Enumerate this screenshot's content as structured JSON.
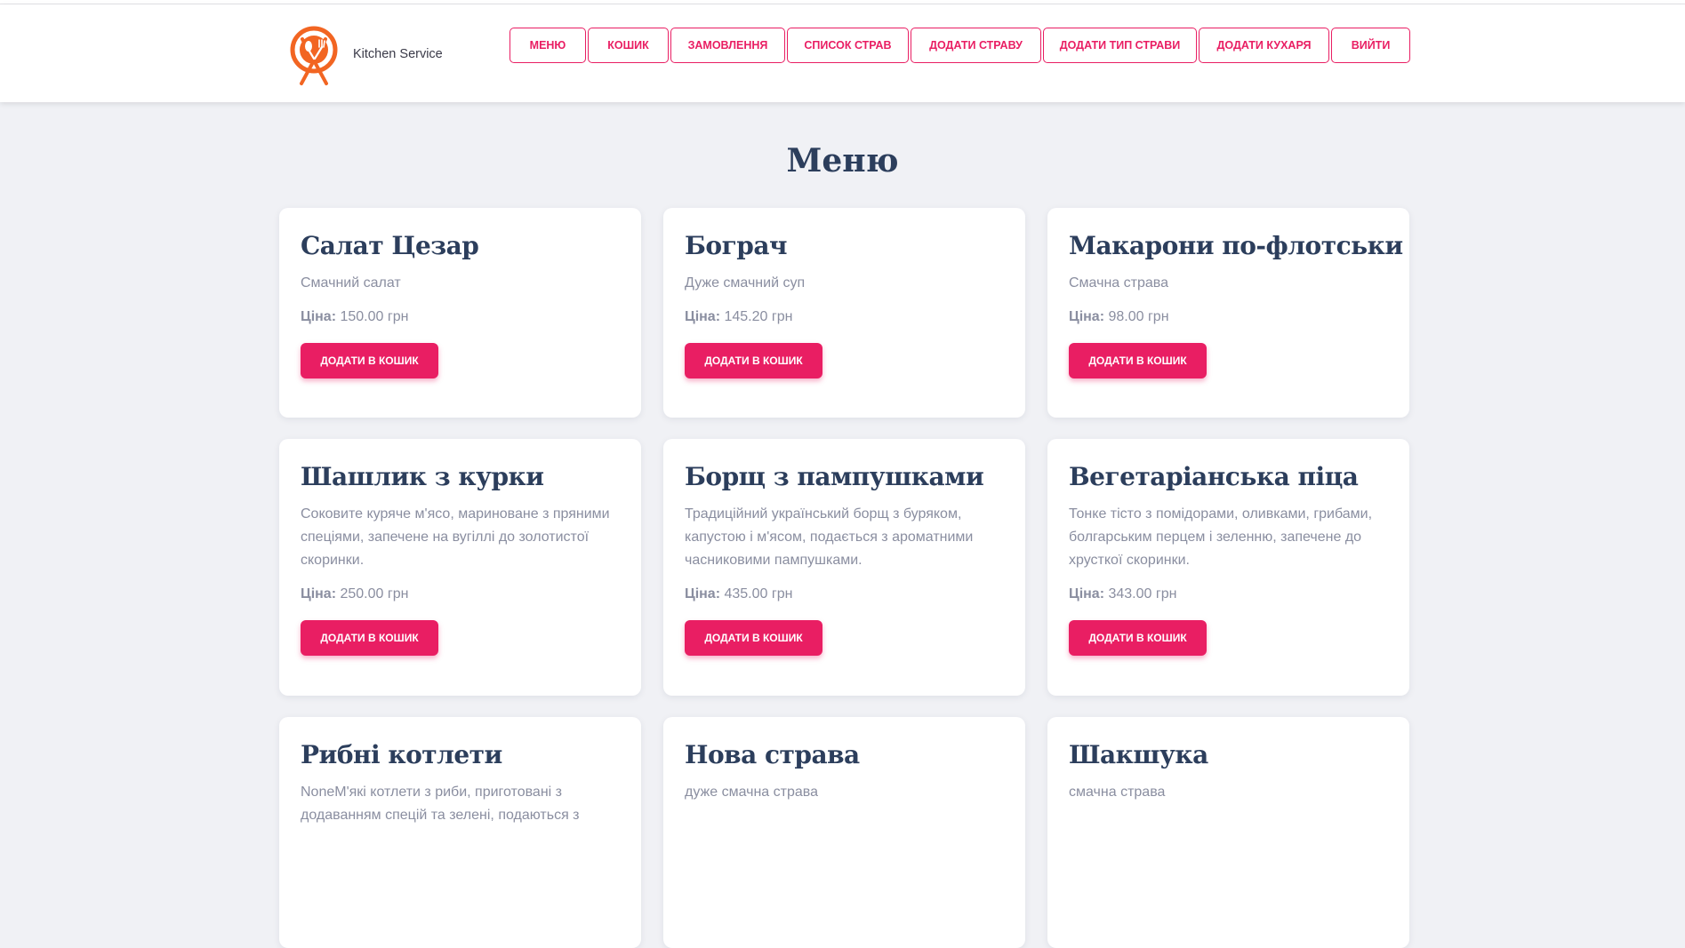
{
  "brand": {
    "name": "Kitchen Service",
    "logo_icon": "plate-fork-spoon-icon",
    "logo_color": "#f26522"
  },
  "nav": [
    {
      "label": "Меню",
      "width": 86
    },
    {
      "label": "Кошик",
      "width": 91
    },
    {
      "label": "Замовлення",
      "width": 129
    },
    {
      "label": "Список страв",
      "width": 137
    },
    {
      "label": "Додати страву",
      "width": 147
    },
    {
      "label": "Додати тип страви",
      "width": 173
    },
    {
      "label": "Додати кухаря",
      "width": 147
    },
    {
      "label": "Вийти",
      "width": 89
    }
  ],
  "page": {
    "title": "Меню"
  },
  "price_label": "Ціна:",
  "add_to_cart_label": "Додати в кошик",
  "dishes": [
    {
      "name": "Салат Цезар",
      "description": "Смачний салат",
      "price": "150.00 грн"
    },
    {
      "name": "Бограч",
      "description": "Дуже смачний суп",
      "price": "145.20 грн"
    },
    {
      "name": "Макарони по-флотськи",
      "description": "Смачна страва",
      "price": "98.00 грн"
    },
    {
      "name": "Шашлик з курки",
      "description": "Соковите куряче м'ясо, мариноване з пряними спеціями, запечене на вугіллі до золотистої скоринки.",
      "price": "250.00 грн"
    },
    {
      "name": "Борщ з пампушками",
      "description": "Традиційний український борщ з буряком, капустою і м'ясом, подається з ароматними часниковими пампушками.",
      "price": "435.00 грн"
    },
    {
      "name": "Вегетаріанська піца",
      "description": "Тонке тісто з помідорами, оливками, грибами, болгарським перцем і зеленню, запечене до хрусткої скоринки.",
      "price": "343.00 грн"
    },
    {
      "name": "Рибні котлети",
      "description": "NoneМ'які котлети з риби, приготовані з додаванням спецій та зелені, подаються з"
    },
    {
      "name": "Нова страва",
      "description": "дуже смачна страва"
    },
    {
      "name": "Шакшука",
      "description": "смачна страва"
    }
  ],
  "colors": {
    "accent": "#e91e63",
    "heading": "#2c3e5c",
    "muted": "#8a8ea0",
    "background": "#f0f1f5"
  }
}
